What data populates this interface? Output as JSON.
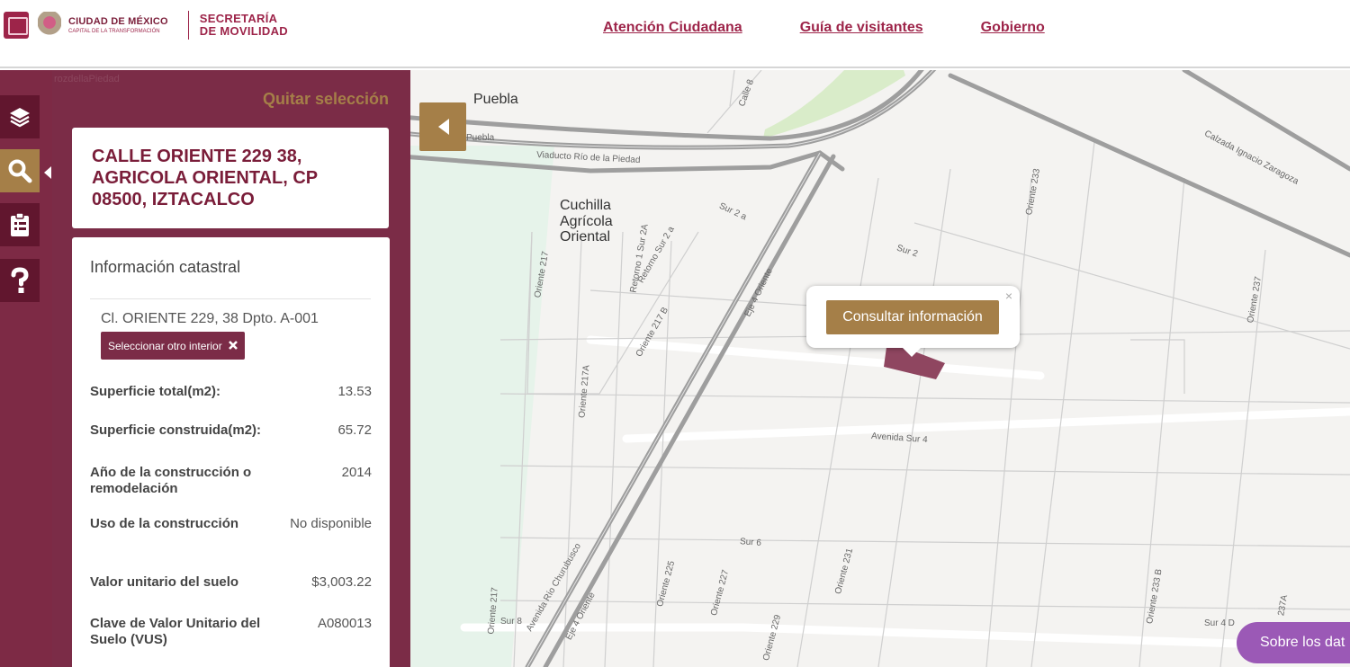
{
  "header": {
    "logo_city": "CIUDAD DE MÉXICO",
    "logo_city_sub": "CAPITAL DE LA TRANSFORMACIÓN",
    "secretaria_l1": "SECRETARÍA",
    "secretaria_l2": "DE MOVILIDAD",
    "nav": [
      "Atención Ciudadana",
      "Guía de visitantes",
      "Gobierno"
    ],
    "brand_color": "#9d2449"
  },
  "sidebar": {
    "tools": [
      "layers-icon",
      "search-icon",
      "clipboard-icon",
      "help-icon"
    ],
    "active_tool": "search-icon"
  },
  "panel": {
    "background_text": "rozdellaPiedad",
    "clear_selection": "Quitar selección",
    "address": "CALLE ORIENTE 229 38, AGRICOLA ORIENTAL, CP 08500, IZTACALCO",
    "info_title": "Información catastral",
    "interior": "Cl. ORIENTE 229, 38 Dpto. A-001",
    "select_other": "Seleccionar otro interior",
    "rows": [
      {
        "label": "Superficie total(m2):",
        "value": "13.53"
      },
      {
        "label": "Superficie construida(m2):",
        "value": "65.72"
      },
      {
        "label": "Año de la construcción o remodelación",
        "value": "2014"
      },
      {
        "label": "Uso de la construcción",
        "value": "No disponible"
      },
      {
        "label": "Valor unitario del suelo",
        "value": "$3,003.22"
      },
      {
        "label": "Clave de Valor Unitario del Suelo (VUS)",
        "value": "A080013"
      }
    ],
    "panel_color": "#7b2c47",
    "accent_color": "#a57f48"
  },
  "map": {
    "labels": {
      "puebla": "Puebla",
      "puebla_small": "Puebla",
      "viaducto": "Viaducto Río de la Piedad",
      "cuchilla": "Cuchilla Agrícola Oriental",
      "calle8": "Calle 8",
      "sur2a": "Sur 2 a",
      "sur2": "Sur 2",
      "oriente233": "Oriente 233",
      "calzada": "Calzada Ignacio Zaragoza",
      "oriente217": "Oriente 217",
      "retorno1": "Retorno 1 Sur 2A",
      "retorno2": "Retorno Sur 2 a",
      "eje4": "Eje 4 Oriente",
      "oriente237": "Oriente 237",
      "oriente217b": "Oriente 217 B",
      "oriente217a": "Oriente 217A",
      "avsur4": "Avenida Sur 4",
      "sur6": "Sur 6",
      "oriente231": "Oriente 231",
      "oriente225": "Oriente 225",
      "oriente227": "Oriente 227",
      "oriente229": "Oriente 229",
      "churubusco": "Avenida Río Churubusco",
      "eje4b": "Eje 4 Oriente",
      "oriente217c": "Oriente 217",
      "sur8": "Sur 8",
      "oriente233b": "Oriente 233 B",
      "sur4d": "Sur 4 D",
      "o237a": "237A"
    },
    "popup_close": "×",
    "consult_button": "Consultar información",
    "about_button": "Sobre los dat"
  }
}
